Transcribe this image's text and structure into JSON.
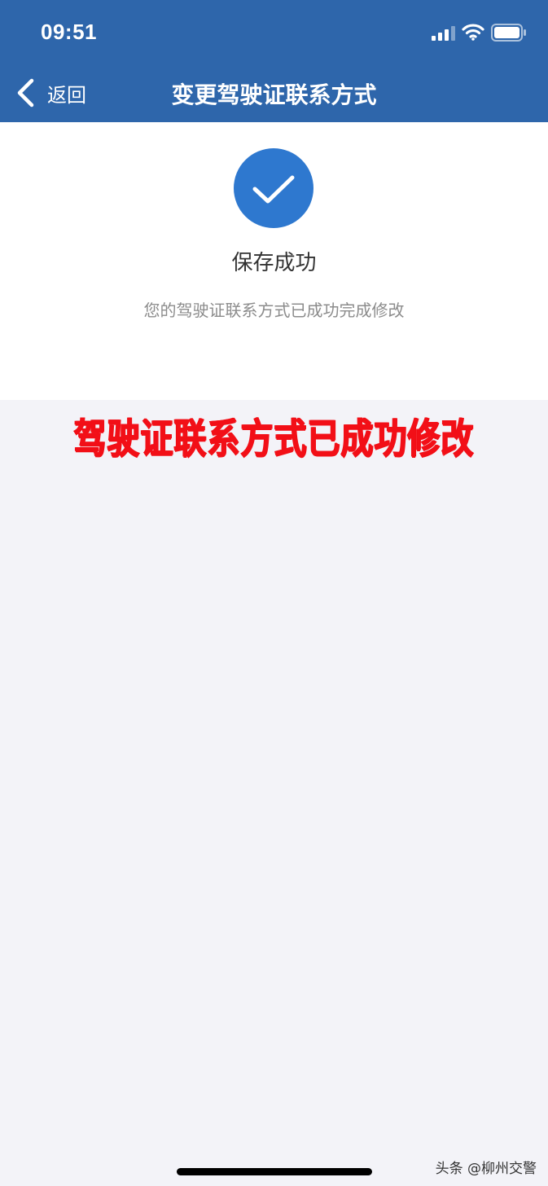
{
  "status_bar": {
    "time": "09:51"
  },
  "nav": {
    "back_label": "返回",
    "title": "变更驾驶证联系方式"
  },
  "result": {
    "title": "保存成功",
    "message": "您的驾驶证联系方式已成功完成修改"
  },
  "annotation": {
    "text": "驾驶证联系方式已成功修改"
  },
  "watermark": {
    "text": "头条 @柳州交警"
  },
  "icons": {
    "signal": "cellular-signal-icon",
    "wifi": "wifi-icon",
    "battery": "battery-icon",
    "back": "chevron-left-icon",
    "success": "checkmark-circle-icon"
  },
  "colors": {
    "header_bg": "#2e66ab",
    "success_blue": "#2e78cf",
    "annotation_red": "#f20f17",
    "page_bg": "#f3f3f8"
  }
}
